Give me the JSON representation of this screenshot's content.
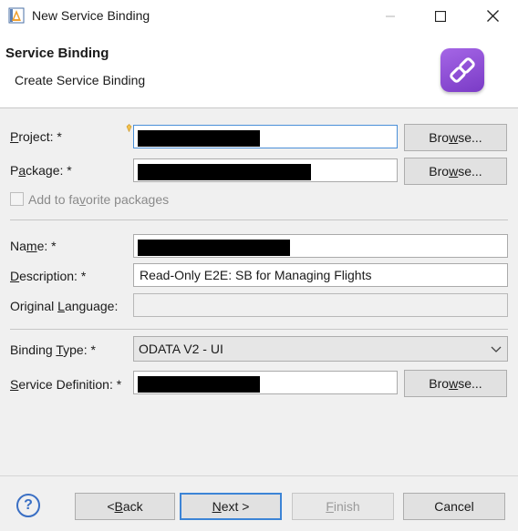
{
  "window": {
    "title": "New Service Binding",
    "icons": {
      "app": "eclipse-adt-icon",
      "minimize": "minimize-icon",
      "maximize": "maximize-icon",
      "close": "close-icon"
    }
  },
  "header": {
    "title": "Service Binding",
    "subtitle": "Create Service Binding",
    "logo_icon": "service-binding-link-icon",
    "logo_color": "#8e4fd8"
  },
  "form": {
    "project": {
      "label_pre": "",
      "label_key": "P",
      "label_post": "roject: *",
      "value": ""
    },
    "package": {
      "label_pre": "P",
      "label_key": "a",
      "label_post": "ckage: *",
      "value": ""
    },
    "favorite": {
      "label_pre": "Add to fa",
      "label_key": "v",
      "label_post": "orite packages",
      "checked": false
    },
    "name": {
      "label_pre": "Na",
      "label_key": "m",
      "label_post": "e: *",
      "value": ""
    },
    "description": {
      "label_pre": "",
      "label_key": "D",
      "label_post": "escription: *",
      "value": "Read-Only E2E: SB for Managing Flights"
    },
    "original_language": {
      "label_pre": "Original ",
      "label_key": "L",
      "label_post": "anguage:",
      "value": ""
    },
    "binding_type": {
      "label_pre": "Binding ",
      "label_key": "T",
      "label_post": "ype: *",
      "value": "ODATA V2 - UI"
    },
    "service_definition": {
      "label_pre": "",
      "label_key": "S",
      "label_post": "ervice Definition: *",
      "value": ""
    },
    "browse": {
      "label_pre": "Bro",
      "label_key": "w",
      "label_post": "se..."
    }
  },
  "footer": {
    "help_glyph": "?",
    "back": {
      "label_pre": "< ",
      "label_key": "B",
      "label_post": "ack"
    },
    "next": {
      "label_pre": "",
      "label_key": "N",
      "label_post": "ext >"
    },
    "finish": {
      "label_pre": "",
      "label_key": "F",
      "label_post": "inish"
    },
    "cancel": "Cancel"
  },
  "colors": {
    "accent": "#3c84d6",
    "logo": "#8e4fd8"
  }
}
